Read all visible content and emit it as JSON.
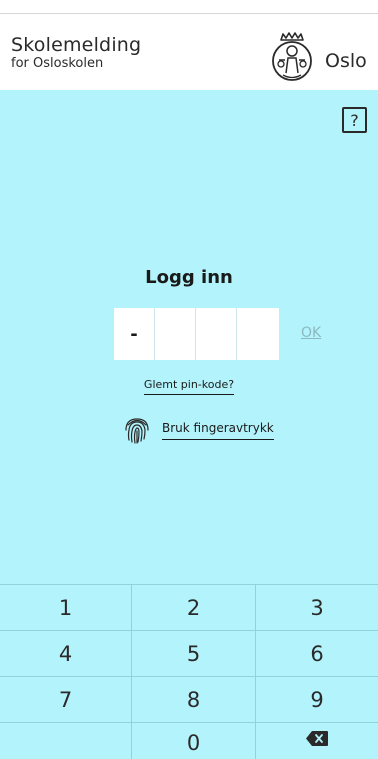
{
  "header": {
    "title": "Skolemelding",
    "subtitle": "for Osloskolen",
    "city": "Oslo",
    "logo_icon": "oslo-city-seal"
  },
  "help": {
    "label": "?"
  },
  "login": {
    "title": "Logg inn",
    "pin_digits": [
      "-",
      "",
      "",
      ""
    ],
    "ok_label": "OK",
    "forgot_label": "Glemt pin-kode?",
    "fingerprint_label": "Bruk fingeravtrykk",
    "fingerprint_icon": "fingerprint-icon"
  },
  "keypad": {
    "keys": [
      "1",
      "2",
      "3",
      "4",
      "5",
      "6",
      "7",
      "8",
      "9",
      "",
      "0",
      ""
    ],
    "backspace_icon": "backspace-icon"
  },
  "colors": {
    "background": "#b3f3fb",
    "header_bg": "#ffffff",
    "ok_disabled": "#8cb9c0",
    "divider": "#8fd3dc"
  }
}
